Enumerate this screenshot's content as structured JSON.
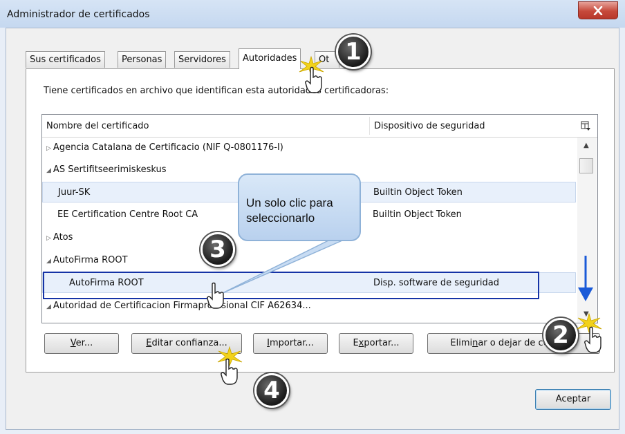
{
  "window": {
    "title": "Administrador de certificados"
  },
  "tabs": [
    {
      "label": "Sus certificados"
    },
    {
      "label": "Personas"
    },
    {
      "label": "Servidores"
    },
    {
      "label": "Autoridades"
    },
    {
      "label": "Ot"
    }
  ],
  "intro": "Tiene certificados en archivo que identifican esta autoridades certificadoras:",
  "tree": {
    "col_name": "Nombre del certificado",
    "col_device": "Dispositivo de seguridad",
    "rows": [
      {
        "name": "Agencia Catalana de Certificacio (NIF Q-0801176-I)",
        "device": ""
      },
      {
        "name": "AS Sertifitseerimiskeskus",
        "device": ""
      },
      {
        "name": "Juur-SK",
        "device": "Builtin Object Token"
      },
      {
        "name": "EE Certification Centre Root CA",
        "device": "Builtin Object Token"
      },
      {
        "name": "Atos",
        "device": ""
      },
      {
        "name": "AutoFirma ROOT",
        "device": ""
      },
      {
        "name": "AutoFirma ROOT",
        "device": "Disp. software de seguridad"
      },
      {
        "name": "Autoridad de Certificacion Firmaprofesional CIF A62634...",
        "device": ""
      }
    ]
  },
  "buttons": {
    "ver": {
      "mn": "V",
      "rest": "er..."
    },
    "editar": {
      "mn": "E",
      "rest": "ditar confianza..."
    },
    "importar": {
      "mn": "I",
      "rest": "mportar..."
    },
    "exportar": {
      "pre": "E",
      "mn": "x",
      "rest": "portar..."
    },
    "eliminar": {
      "pre": "Elimi",
      "mn": "n",
      "rest": "ar o dejar de confiar..."
    },
    "aceptar": "Aceptar"
  },
  "annotations": {
    "callout": "Un solo clic para seleccionarlo",
    "steps": [
      "1",
      "2",
      "3",
      "4"
    ],
    "accent_color": "#1533a6"
  }
}
